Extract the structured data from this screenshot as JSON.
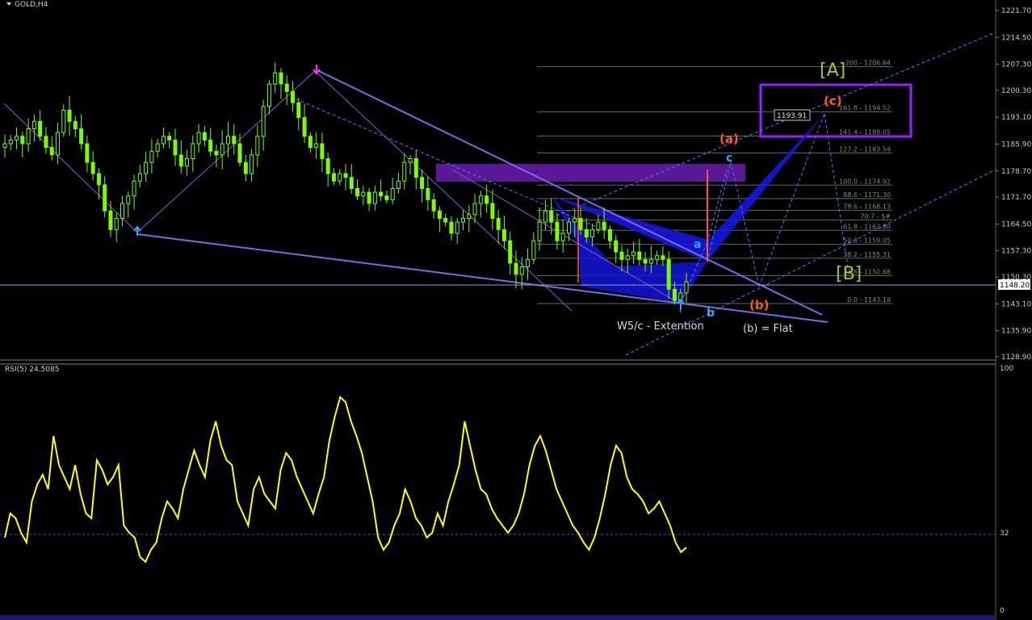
{
  "header": {
    "symbol_label": "GOLD,H4",
    "indicator_label": "RSI(5) 24.5085"
  },
  "colors": {
    "background": "#000000",
    "price_bars": "#7cfc00",
    "rsi_line": "#ffff00",
    "channel_lines": "#7b68ee",
    "pattern_fill": "#1010e8",
    "zone_fill": "#7a20c8",
    "target_box": "#9a20ff",
    "wave_red": "#ff5a1f",
    "wave_blue": "#29a8ff",
    "wave_big": "#9acd32"
  },
  "price_axis": {
    "ticks": [
      "1221.70",
      "1214.50",
      "1207.30",
      "1200.30",
      "1193.10",
      "1185.90",
      "1178.70",
      "1171.70",
      "1164.50",
      "1157.30",
      "1150.30",
      "1143.10",
      "1135.90",
      "1128.90"
    ],
    "current_price": "1148.20"
  },
  "rsi_axis": {
    "ticks": [
      "100",
      "32",
      "0"
    ]
  },
  "annotations": {
    "price_box": "1193.91",
    "wave_A": "[A]",
    "wave_B": "[B]",
    "wave_a_red": "(a)",
    "wave_b_red": "(b)",
    "wave_c_red": "(c)",
    "wave_a_blue": "a",
    "wave_b_blue": "b",
    "wave_c_blue": "c",
    "w5_note": "W5/c - Extention",
    "flat_note": "(b) = Flat"
  },
  "fib_levels": [
    {
      "label": "200 - 1206.64",
      "price": 1206.64
    },
    {
      "label": "161.8 - 1194.52",
      "price": 1194.52
    },
    {
      "label": "141.4 - 1188.05",
      "price": 1188.05
    },
    {
      "label": "127.2 - 1183.54",
      "price": 1183.54
    },
    {
      "label": "100.0 - 1174.92",
      "price": 1174.92
    },
    {
      "label": "88.6 - 1171.30",
      "price": 1171.3
    },
    {
      "label": "78.6 - 1168.13",
      "price": 1168.13
    },
    {
      "label": "70.7 - $#",
      "price": 1165.6
    },
    {
      "label": "61.8 - 1162.80",
      "price": 1162.8
    },
    {
      "label": "50.0 - 1159.05",
      "price": 1159.05
    },
    {
      "label": "38.2 - 1155.31",
      "price": 1155.31
    },
    {
      "label": "23.6 - 1150.68",
      "price": 1150.68
    },
    {
      "label": "0.0 - 1143.19",
      "price": 1143.19
    }
  ],
  "chart_data": [
    {
      "type": "candlestick",
      "title": "GOLD,H4",
      "ylim": [
        1128.9,
        1221.7
      ],
      "series": [
        {
          "name": "GOLD",
          "close": [
            1186,
            1187,
            1188,
            1186,
            1190,
            1192,
            1188,
            1185,
            1183,
            1189,
            1195,
            1192,
            1190,
            1186,
            1181,
            1178,
            1175,
            1168,
            1163,
            1166,
            1170,
            1172,
            1176,
            1178,
            1181,
            1184,
            1186,
            1188,
            1187,
            1183,
            1180,
            1182,
            1186,
            1189,
            1187,
            1184,
            1183,
            1186,
            1188,
            1186,
            1181,
            1178,
            1183,
            1188,
            1196,
            1202,
            1205,
            1202,
            1200,
            1197,
            1193,
            1188,
            1185,
            1186,
            1182,
            1178,
            1176,
            1178,
            1177,
            1174,
            1172,
            1173,
            1170,
            1173,
            1172,
            1171,
            1174,
            1176,
            1181,
            1182,
            1177,
            1174,
            1171,
            1168,
            1166,
            1165,
            1162,
            1165,
            1166,
            1167,
            1170,
            1172,
            1170,
            1166,
            1163,
            1160,
            1154,
            1151,
            1153,
            1155,
            1160,
            1165,
            1168,
            1165,
            1160,
            1162,
            1165,
            1166,
            1163,
            1161,
            1163,
            1165,
            1163,
            1160,
            1157,
            1155,
            1156,
            1157,
            1155,
            1154,
            1155,
            1156,
            1155,
            1147,
            1144,
            1146,
            1149
          ]
        }
      ]
    },
    {
      "type": "line",
      "title": "RSI(5) 24.5085",
      "ylim": [
        0,
        100
      ],
      "series": [
        {
          "name": "RSI(5)",
          "values": [
            30,
            40,
            38,
            32,
            28,
            45,
            52,
            56,
            50,
            72,
            60,
            55,
            50,
            60,
            48,
            40,
            38,
            62,
            58,
            52,
            55,
            60,
            35,
            32,
            30,
            22,
            20,
            25,
            28,
            38,
            45,
            42,
            38,
            50,
            58,
            66,
            60,
            55,
            70,
            78,
            68,
            62,
            60,
            45,
            40,
            35,
            50,
            55,
            48,
            45,
            42,
            58,
            65,
            62,
            55,
            50,
            45,
            40,
            48,
            55,
            70,
            80,
            88,
            86,
            78,
            72,
            65,
            55,
            45,
            30,
            25,
            28,
            35,
            40,
            50,
            45,
            38,
            35,
            30,
            32,
            40,
            35,
            45,
            52,
            60,
            78,
            68,
            58,
            50,
            48,
            42,
            38,
            35,
            32,
            35,
            40,
            48,
            60,
            68,
            72,
            66,
            58,
            50,
            45,
            40,
            35,
            32,
            28,
            25,
            30,
            38,
            48,
            60,
            68,
            65,
            55,
            50,
            48,
            45,
            40,
            42,
            45,
            40,
            35,
            28,
            24,
            26
          ]
        }
      ],
      "reference_level": 32
    }
  ]
}
